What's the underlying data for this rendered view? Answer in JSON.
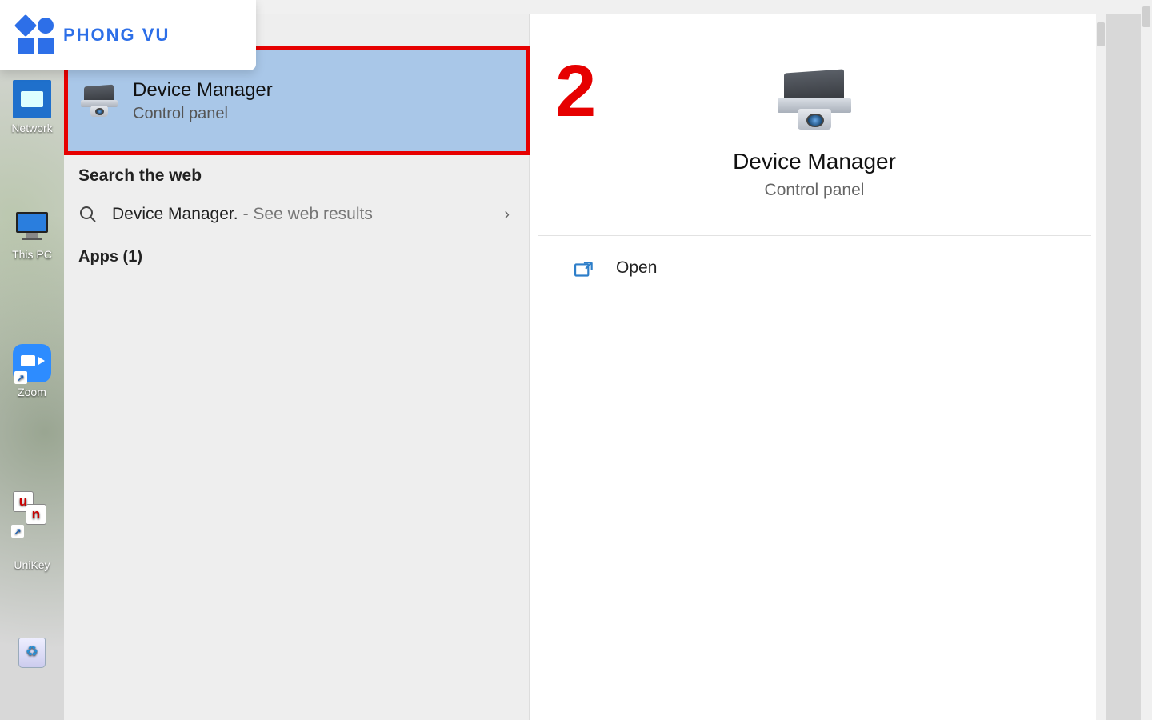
{
  "logo": {
    "text": "PHONG VU"
  },
  "desktop": {
    "icons": [
      {
        "label": "Network"
      },
      {
        "label": "This PC"
      },
      {
        "label": "Zoom"
      },
      {
        "label": "UniKey"
      },
      {
        "label": "Recycle Bin"
      }
    ]
  },
  "search": {
    "best_match": {
      "title": "Device Manager",
      "subtitle": "Control panel"
    },
    "web_section": "Search the web",
    "web_result": {
      "query": "Device Manager.",
      "hint": "- See web results"
    },
    "apps_section": "Apps (1)"
  },
  "preview": {
    "title": "Device Manager",
    "subtitle": "Control panel",
    "actions": {
      "open": "Open"
    }
  },
  "annotation": {
    "step": "2"
  }
}
